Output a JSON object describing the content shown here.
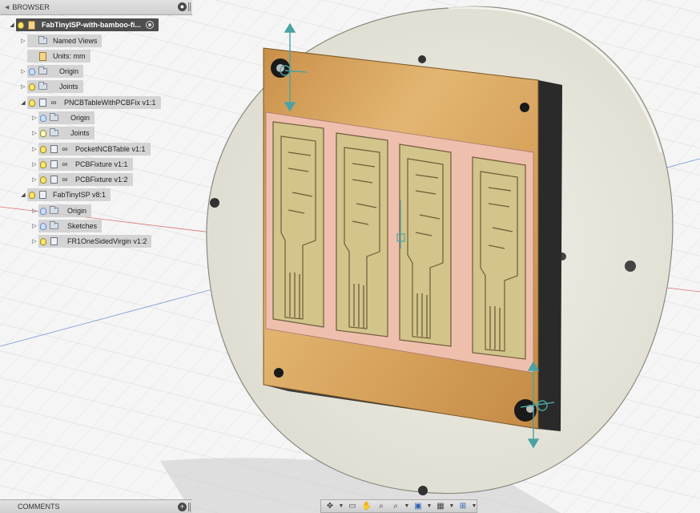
{
  "browser": {
    "title": "BROWSER",
    "root": "FabTinyISP-with-bamboo-fi...",
    "items": [
      {
        "label": "Named Views"
      },
      {
        "label": "Units: mm"
      },
      {
        "label": "Origin"
      },
      {
        "label": "Joints"
      },
      {
        "label": "PNCBTableWithPCBFix v1:1"
      },
      {
        "label": "Origin"
      },
      {
        "label": "Joints"
      },
      {
        "label": "PocketNCBTable v1:1"
      },
      {
        "label": "PCBFixture v1:1"
      },
      {
        "label": "PCBFixture v1:2"
      },
      {
        "label": "FabTinyISP v8:1"
      },
      {
        "label": "Origin"
      },
      {
        "label": "Sketches"
      },
      {
        "label": "FR1OneSidedVirgin v1:2"
      }
    ]
  },
  "comments": {
    "title": "COMMENTS"
  },
  "icons": {
    "visibility": "lightbulb-icon",
    "folder": "folder-icon",
    "component": "component-icon",
    "link": "link-icon",
    "navbar": [
      "orbit-icon",
      "look-at-icon",
      "pan-icon",
      "zoom-icon",
      "zoom-window-icon",
      "display-settings-icon",
      "grid-icon",
      "viewports-icon"
    ]
  },
  "colors": {
    "panel_bg": "#d0d0d0",
    "root_bg": "#4e4e4e",
    "wood": "#d9a863",
    "pcb_pink": "#f2c0b0",
    "pcb_trace": "#d8cf92",
    "disc": "#e7e6dc"
  }
}
